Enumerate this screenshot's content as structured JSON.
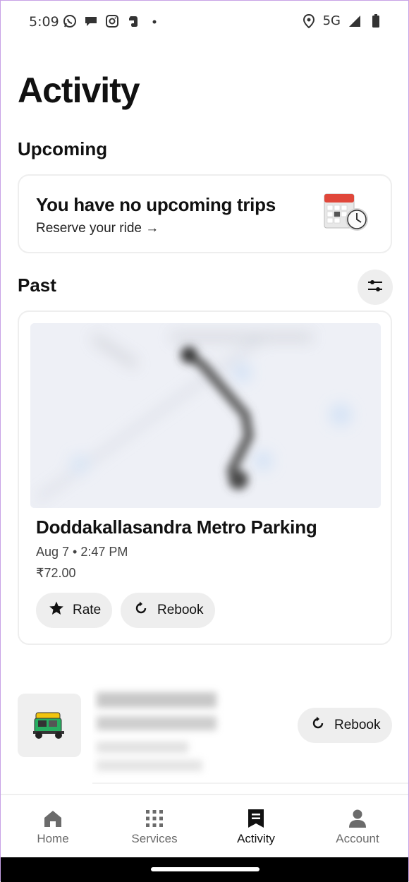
{
  "status_bar": {
    "time": "5:09",
    "network": "5G",
    "left_icons": [
      "whatsapp-icon",
      "chat-bubble-icon",
      "instagram-icon",
      "evernote-icon",
      "dot-icon"
    ],
    "right_icons": [
      "location-pin-icon",
      "signal-icon",
      "battery-icon"
    ]
  },
  "page": {
    "title": "Activity"
  },
  "upcoming": {
    "heading": "Upcoming",
    "card_title": "You have no upcoming trips",
    "link_text": "Reserve your ride →",
    "illustration": "calendar-clock-icon"
  },
  "past": {
    "heading": "Past",
    "filter_icon": "filter-sliders-icon",
    "trip": {
      "destination": "Doddakallasandra Metro Parking",
      "datetime": "Aug 7 • 2:47 PM",
      "price": "₹72.00",
      "rate_label": "Rate",
      "rebook_label": "Rebook"
    },
    "second_trip": {
      "vehicle": "auto-rickshaw-icon",
      "rebook_label": "Rebook"
    }
  },
  "bottom_nav": {
    "items": [
      {
        "label": "Home",
        "icon": "home-icon",
        "active": false
      },
      {
        "label": "Services",
        "icon": "grid-icon",
        "active": false
      },
      {
        "label": "Activity",
        "icon": "receipt-icon",
        "active": true
      },
      {
        "label": "Account",
        "icon": "person-icon",
        "active": false
      }
    ]
  },
  "colors": {
    "accent_text": "#111111",
    "muted_text": "#6b6b6b",
    "pill_bg": "#eeeeee"
  }
}
